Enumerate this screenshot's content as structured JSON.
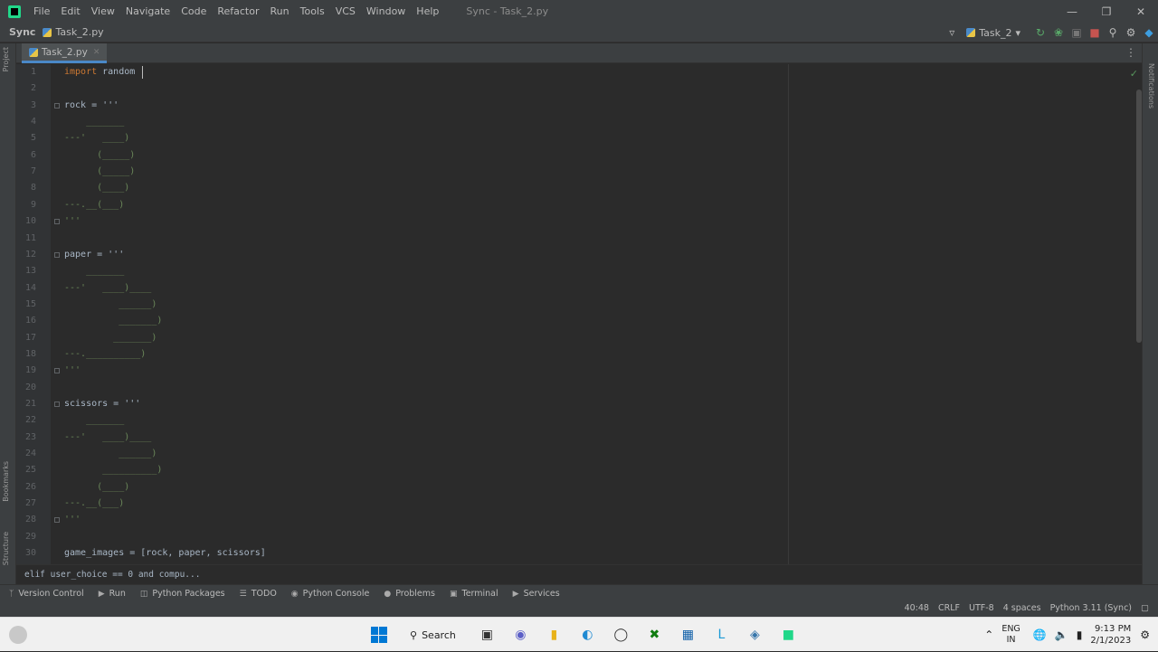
{
  "titlebar": {
    "menu": [
      "File",
      "Edit",
      "View",
      "Navigate",
      "Code",
      "Refactor",
      "Run",
      "Tools",
      "VCS",
      "Window",
      "Help"
    ],
    "title": "Sync - Task_2.py"
  },
  "navbar": {
    "project": "Sync",
    "file": "Task_2.py",
    "run_config": "Task_2"
  },
  "side_tabs": {
    "left": [
      "Project",
      "Bookmarks",
      "Structure"
    ],
    "right": [
      "Notifications"
    ]
  },
  "editor": {
    "active_tab": "Task_2.py",
    "lines": [
      {
        "n": "1",
        "text": "import random",
        "kind": "import"
      },
      {
        "n": "2",
        "text": ""
      },
      {
        "n": "3",
        "text": "rock = '''",
        "fold": true
      },
      {
        "n": "4",
        "text": "    _______"
      },
      {
        "n": "5",
        "text": "---'   ____)"
      },
      {
        "n": "6",
        "text": "      (_____)"
      },
      {
        "n": "7",
        "text": "      (_____)"
      },
      {
        "n": "8",
        "text": "      (____)"
      },
      {
        "n": "9",
        "text": "---.__(___)"
      },
      {
        "n": "10",
        "text": "'''",
        "fold": true
      },
      {
        "n": "11",
        "text": ""
      },
      {
        "n": "12",
        "text": "paper = '''",
        "fold": true
      },
      {
        "n": "13",
        "text": "    _______"
      },
      {
        "n": "14",
        "text": "---'   ____)____"
      },
      {
        "n": "15",
        "text": "          ______)"
      },
      {
        "n": "16",
        "text": "          _______)"
      },
      {
        "n": "17",
        "text": "         _______)"
      },
      {
        "n": "18",
        "text": "---.__________)"
      },
      {
        "n": "19",
        "text": "'''",
        "fold": true
      },
      {
        "n": "20",
        "text": ""
      },
      {
        "n": "21",
        "text": "scissors = '''",
        "fold": true
      },
      {
        "n": "22",
        "text": "    _______"
      },
      {
        "n": "23",
        "text": "---'   ____)____"
      },
      {
        "n": "24",
        "text": "          ______)"
      },
      {
        "n": "25",
        "text": "       __________)"
      },
      {
        "n": "26",
        "text": "      (____)"
      },
      {
        "n": "27",
        "text": "---.__(___)"
      },
      {
        "n": "28",
        "text": "'''",
        "fold": true
      },
      {
        "n": "29",
        "text": ""
      },
      {
        "n": "30",
        "text": "game_images = [rock, paper, scissors]"
      }
    ]
  },
  "breadcrumb": "elif user_choice == 0 and compu...",
  "toolwindows": [
    "Version Control",
    "Run",
    "Python Packages",
    "TODO",
    "Python Console",
    "Problems",
    "Terminal",
    "Services"
  ],
  "status": {
    "position": "40:48",
    "line_sep": "CRLF",
    "encoding": "UTF-8",
    "indent": "4 spaces",
    "interpreter": "Python 3.11 (Sync)"
  },
  "taskbar": {
    "search": "Search",
    "lang_top": "ENG",
    "lang_bottom": "IN",
    "time": "9:13 PM",
    "date": "2/1/2023"
  }
}
